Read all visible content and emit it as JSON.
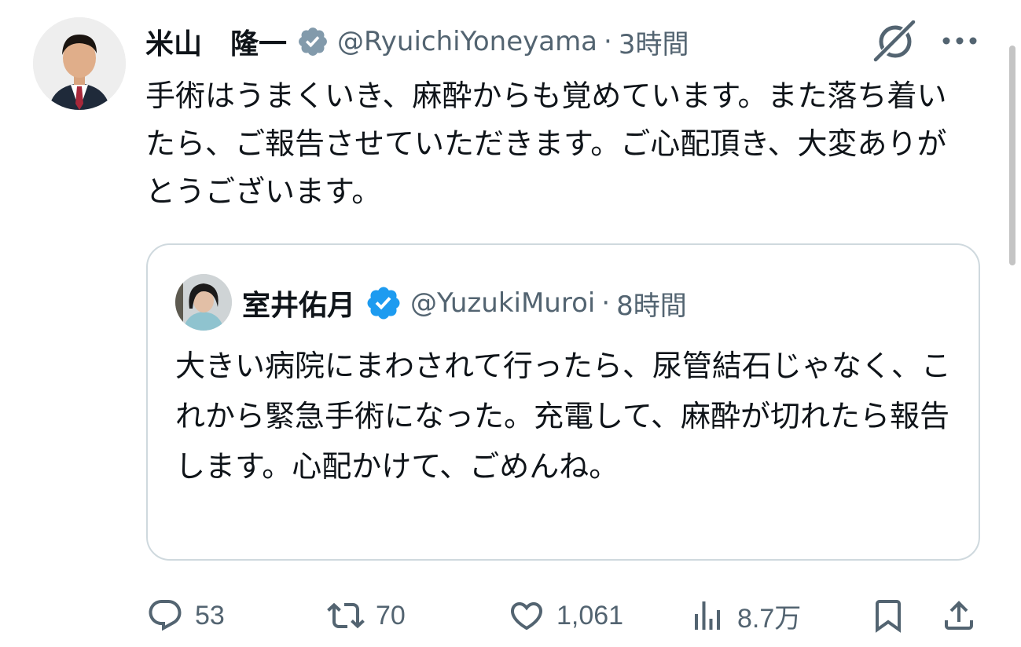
{
  "tweet": {
    "author_name": "米山　隆一",
    "handle": "@RyuichiYoneyama",
    "separator": "·",
    "time": "3時間",
    "text": "手術はうまくいき、麻酔からも覚めています。また落ち着いたら、ご報告させていただきます。ご心配頂き、大変ありがとうございます。",
    "verified_badge_color": "#829aab"
  },
  "quote": {
    "author_name": "室井佑月",
    "handle": "@YuzukiMuroi",
    "separator": "·",
    "time": "8時間",
    "text": "大きい病院にまわされて行ったら、尿管結石じゃなく、これから緊急手術になった。充電して、麻酔が切れたら報告します。心配かけて、ごめんね。",
    "verified_badge_color": "#1d9bf0"
  },
  "actions": {
    "replies": "53",
    "reposts": "70",
    "likes": "1,061",
    "views": "8.7万"
  },
  "icons": {
    "header": [
      "grok-icon",
      "more-icon"
    ],
    "actions": [
      "reply-icon",
      "repost-icon",
      "like-icon",
      "views-icon",
      "bookmark-icon",
      "share-icon"
    ]
  },
  "colors": {
    "text": "#0f1419",
    "secondary": "#536471",
    "border": "#cfd9de"
  }
}
